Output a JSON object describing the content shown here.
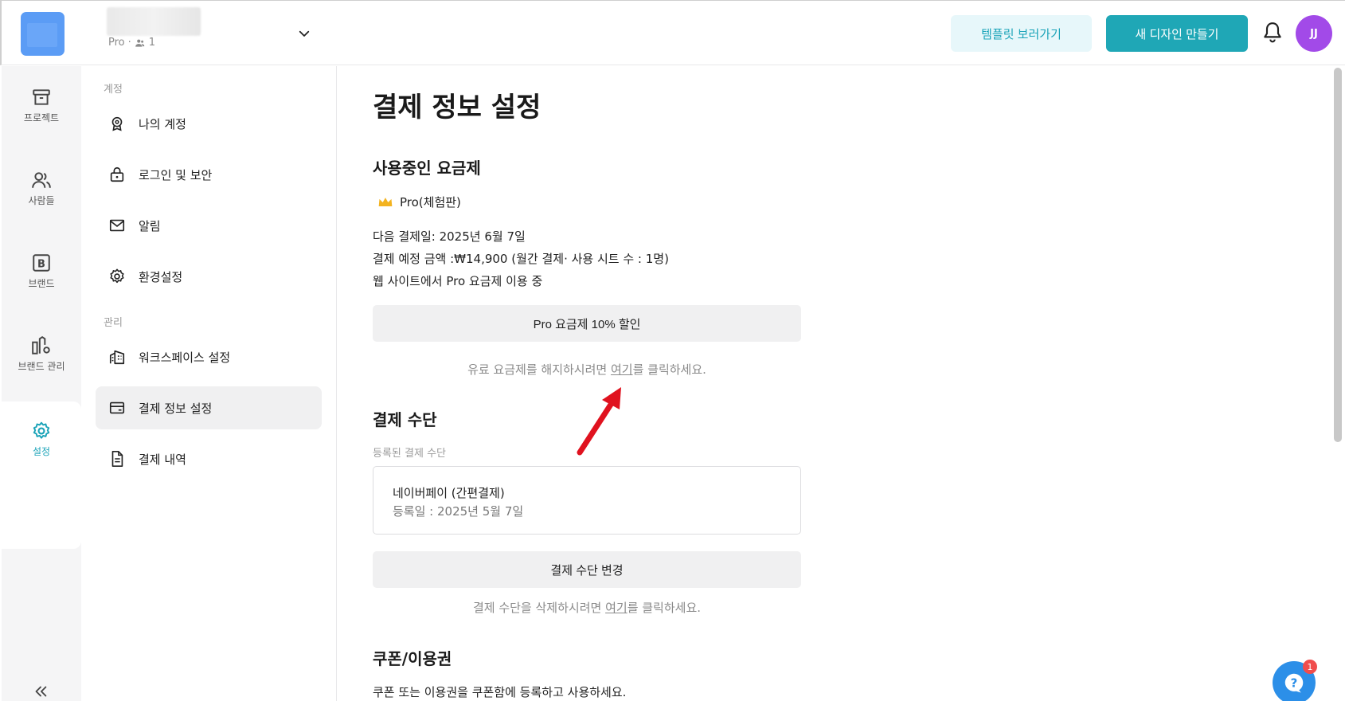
{
  "header": {
    "workspace_plan": "Pro",
    "member_count": "1",
    "template_button": "템플릿 보러가기",
    "new_design_button": "새 디자인 만들기",
    "avatar_initials": "JJ"
  },
  "rail": {
    "items": [
      {
        "label": "프로젝트",
        "icon": "archive-icon"
      },
      {
        "label": "사람들",
        "icon": "people-icon"
      },
      {
        "label": "브랜드",
        "icon": "brand-b-icon"
      },
      {
        "label": "브랜드 관리",
        "icon": "brand-manage-icon"
      },
      {
        "label": "설정",
        "icon": "gear-icon"
      }
    ]
  },
  "sidebar": {
    "section_account": "계정",
    "section_manage": "관리",
    "items": [
      {
        "label": "나의 계정"
      },
      {
        "label": "로그인 및 보안"
      },
      {
        "label": "알림"
      },
      {
        "label": "환경설정"
      },
      {
        "label": "워크스페이스 설정"
      },
      {
        "label": "결제 정보 설정"
      },
      {
        "label": "결제 내역"
      }
    ]
  },
  "main": {
    "title": "결제 정보 설정",
    "plan_section_title": "사용중인 요금제",
    "plan_name": "Pro(체험판)",
    "next_payment": "다음 결제일: 2025년 6월 7일",
    "payment_amount": "결제 예정 금액 :₩14,900 (월간 결제· 사용 시트 수 : 1명)",
    "plan_source": "웹 사이트에서 Pro 요금제 이용 중",
    "discount_button": "Pro 요금제 10% 할인",
    "cancel_note_before": "유료 요금제를 해지하시려면 ",
    "cancel_note_link": "여기",
    "cancel_note_after": "를 클릭하세요.",
    "payment_method_title": "결제 수단",
    "registered_label": "등록된 결제 수단",
    "payment_method_name": "네이버페이 (간편결제)",
    "payment_method_date": "등록일 : 2025년 5월 7일",
    "change_method_button": "결제 수단 변경",
    "delete_note_before": "결제 수단을 삭제하시려면  ",
    "delete_note_link": "여기",
    "delete_note_after": "를 클릭하세요.",
    "coupon_title": "쿠폰/이용권",
    "coupon_desc": "쿠폰 또는 이용권을 쿠폰함에 등록하고 사용하세요."
  },
  "help": {
    "badge_count": "1"
  },
  "colors": {
    "accent": "#1fa7b6",
    "accent_light": "#e7f7fa",
    "avatar": "#a24ae8",
    "annotation_arrow": "#e0121f"
  }
}
